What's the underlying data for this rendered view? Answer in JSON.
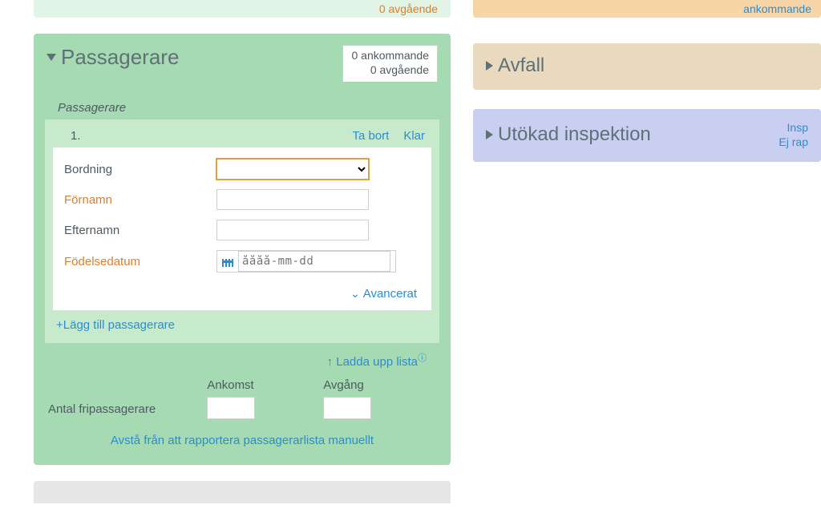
{
  "leftSliver": {
    "departing": "0 avgående"
  },
  "rightSliver": {
    "text": "ankommande"
  },
  "passengers": {
    "title": "Passagerare",
    "badge_line1": "0 ankommande",
    "badge_line2": "0 avgående",
    "subheading": "Passagerare",
    "item": {
      "number": "1.",
      "remove": "Ta bort",
      "done": "Klar",
      "boarding_label": "Bordning",
      "firstname_label": "Förnamn",
      "lastname_label": "Efternamn",
      "dob_label": "Födelsedatum",
      "dob_placeholder": "åååå-mm-dd",
      "advanced": "Avancerat"
    },
    "add": "Lägg till passagerare",
    "upload": "Ladda upp lista",
    "free_label": "Antal fripassagerare",
    "arrival": "Ankomst",
    "departure": "Avgång",
    "opt_out": "Avstå från att rapportera passagerarlista manuellt"
  },
  "avfall": {
    "title": "Avfall"
  },
  "inspection": {
    "title": "Utökad inspektion",
    "line1": "Insp",
    "line2": "Ej rap"
  }
}
